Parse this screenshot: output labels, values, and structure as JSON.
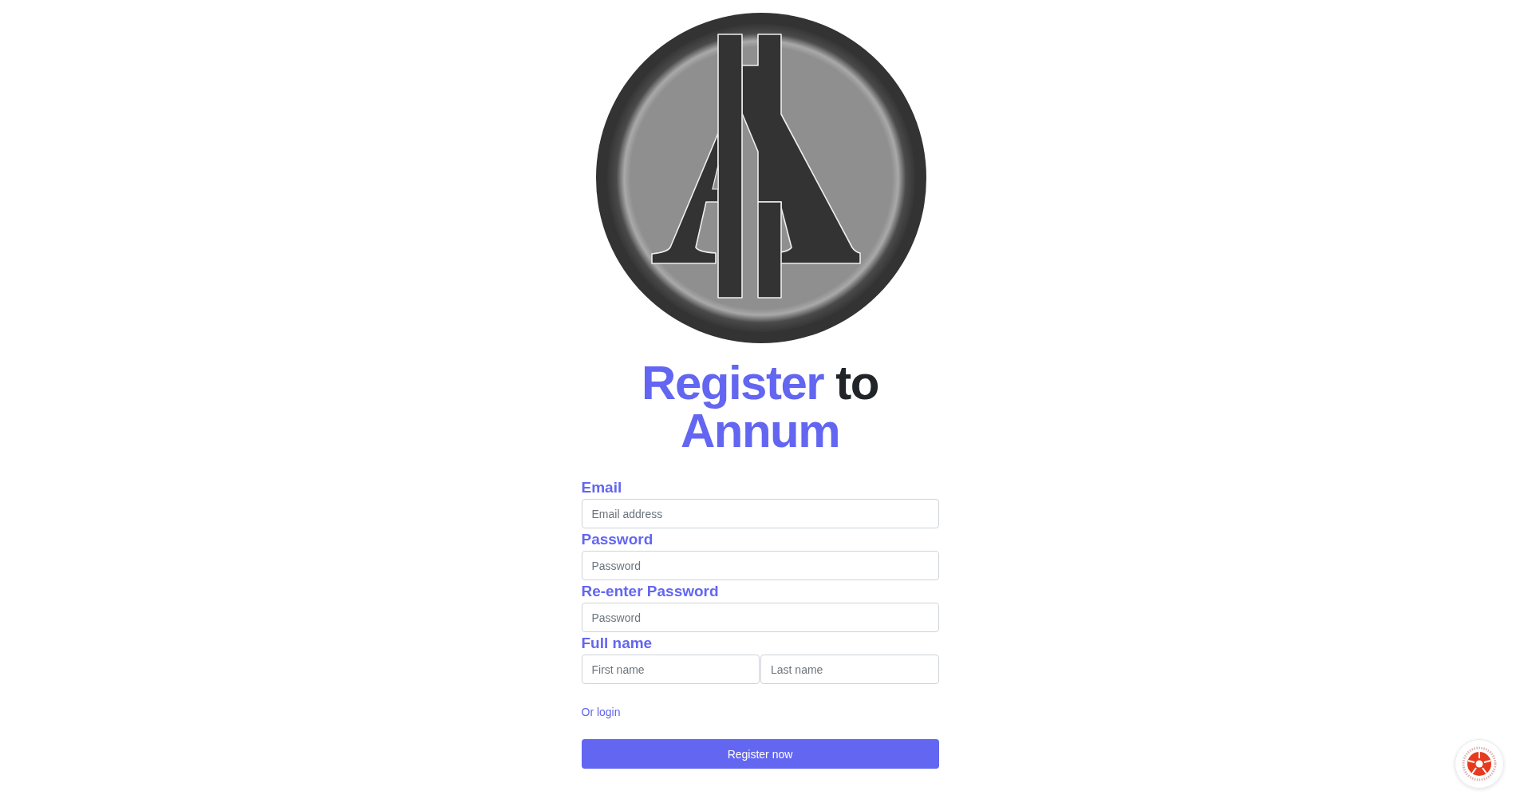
{
  "title": [
    {
      "text": "Register",
      "accent": true
    },
    {
      "text": "to",
      "accent": false
    },
    {
      "text": "Annum",
      "accent": true
    }
  ],
  "form": {
    "fields": [
      {
        "label": "Email",
        "inputs": [
          {
            "placeholder": "Email address"
          }
        ]
      },
      {
        "label": "Password",
        "inputs": [
          {
            "placeholder": "Password"
          }
        ]
      },
      {
        "label": "Re-enter Password",
        "inputs": [
          {
            "placeholder": "Password"
          }
        ]
      },
      {
        "label": "Full name",
        "inputs": [
          {
            "placeholder": "First name"
          },
          {
            "placeholder": "Last name"
          }
        ]
      }
    ],
    "login_link": "Or login",
    "submit_button": "Register now"
  }
}
